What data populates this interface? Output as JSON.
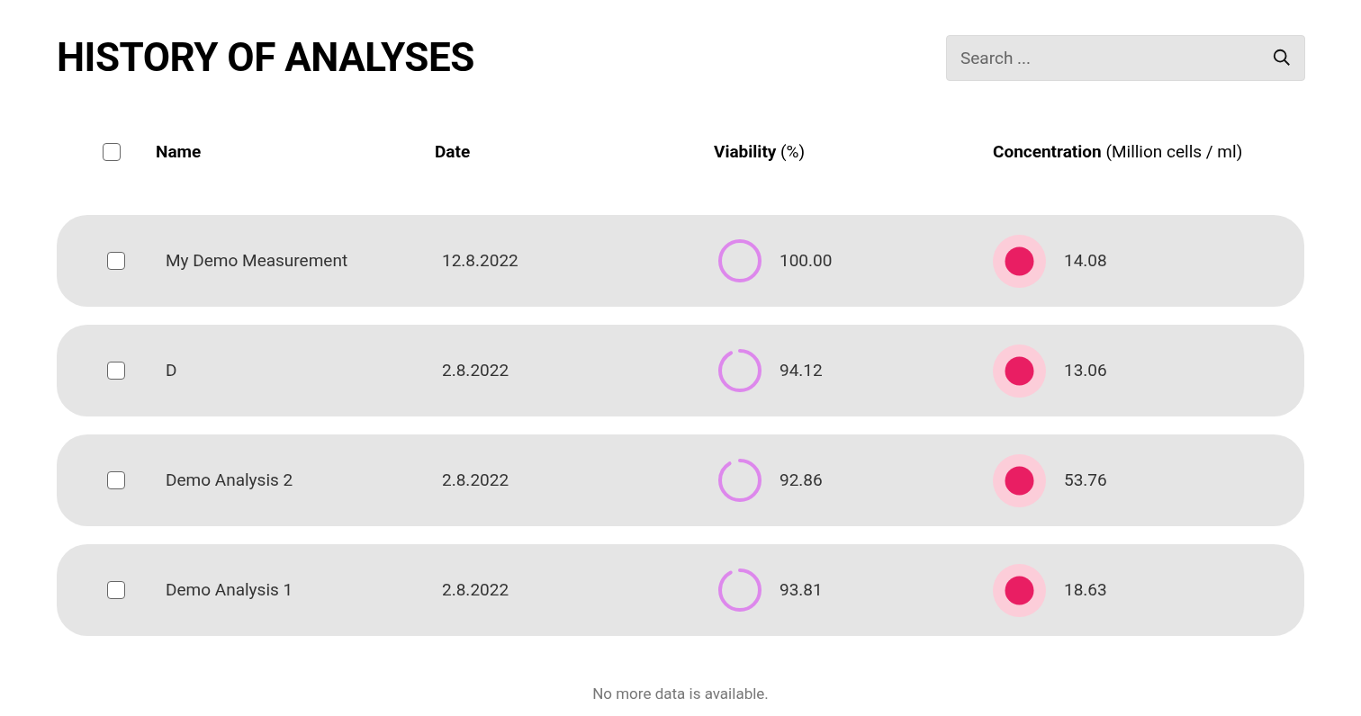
{
  "title": "HISTORY OF ANALYSES",
  "search": {
    "placeholder": "Search ..."
  },
  "header": {
    "select_all": {
      "checked": false
    },
    "columns": [
      "Name",
      "Date",
      "**Viability** (%)",
      "**Concentration** (Million cells / ml)"
    ]
  },
  "rows": [
    {
      "checked": false,
      "name": "My Demo Measurement",
      "date": "12.8.2022",
      "viability": "100.00",
      "level": 1.0,
      "concentration": "14.08"
    },
    {
      "checked": false,
      "name": "D",
      "date": "2.8.2022",
      "viability": "94.12",
      "level": 0.9412,
      "concentration": "13.06"
    },
    {
      "checked": false,
      "name": "Demo Analysis 2",
      "date": "2.8.2022",
      "viability": "92.86",
      "level": 0.9286,
      "concentration": "53.76"
    },
    {
      "checked": false,
      "name": "Demo Analysis 1",
      "date": "2.8.2022",
      "viability": "93.81",
      "level": 0.9381,
      "concentration": "18.63"
    }
  ],
  "footer": "No more data is available."
}
